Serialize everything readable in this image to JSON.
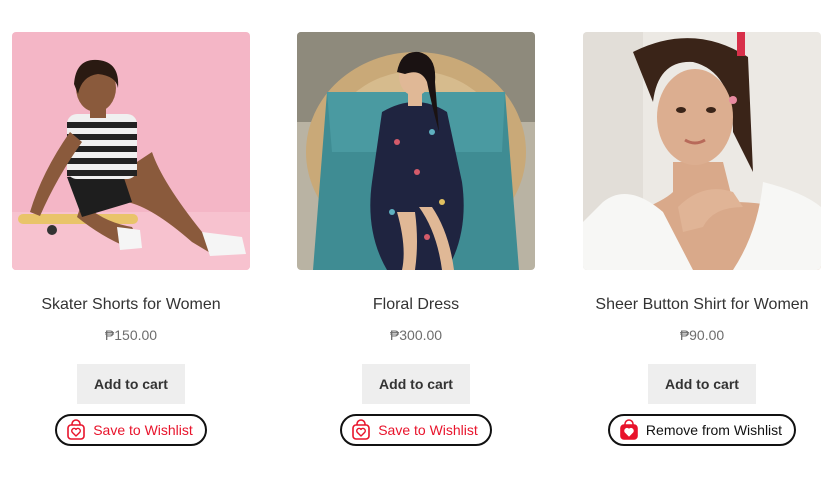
{
  "products": [
    {
      "title": "Skater Shorts for Women",
      "price": "₱150.00",
      "cart_label": "Add to cart",
      "wishlist_label": "Save to Wishlist",
      "wishlist_state": "save"
    },
    {
      "title": "Floral Dress",
      "price": "₱300.00",
      "cart_label": "Add to cart",
      "wishlist_label": "Save to Wishlist",
      "wishlist_state": "save"
    },
    {
      "title": "Sheer Button Shirt for Women",
      "price": "₱90.00",
      "cart_label": "Add to cart",
      "wishlist_label": "Remove from Wishlist",
      "wishlist_state": "remove"
    }
  ],
  "colors": {
    "wishlist_red": "#e8132b",
    "cart_button_bg": "#eeeeee",
    "price_gray": "#6d6d6d"
  },
  "icons": {
    "wishlist_save": "heart-bag-outline-icon",
    "wishlist_remove": "heart-bag-filled-icon"
  }
}
